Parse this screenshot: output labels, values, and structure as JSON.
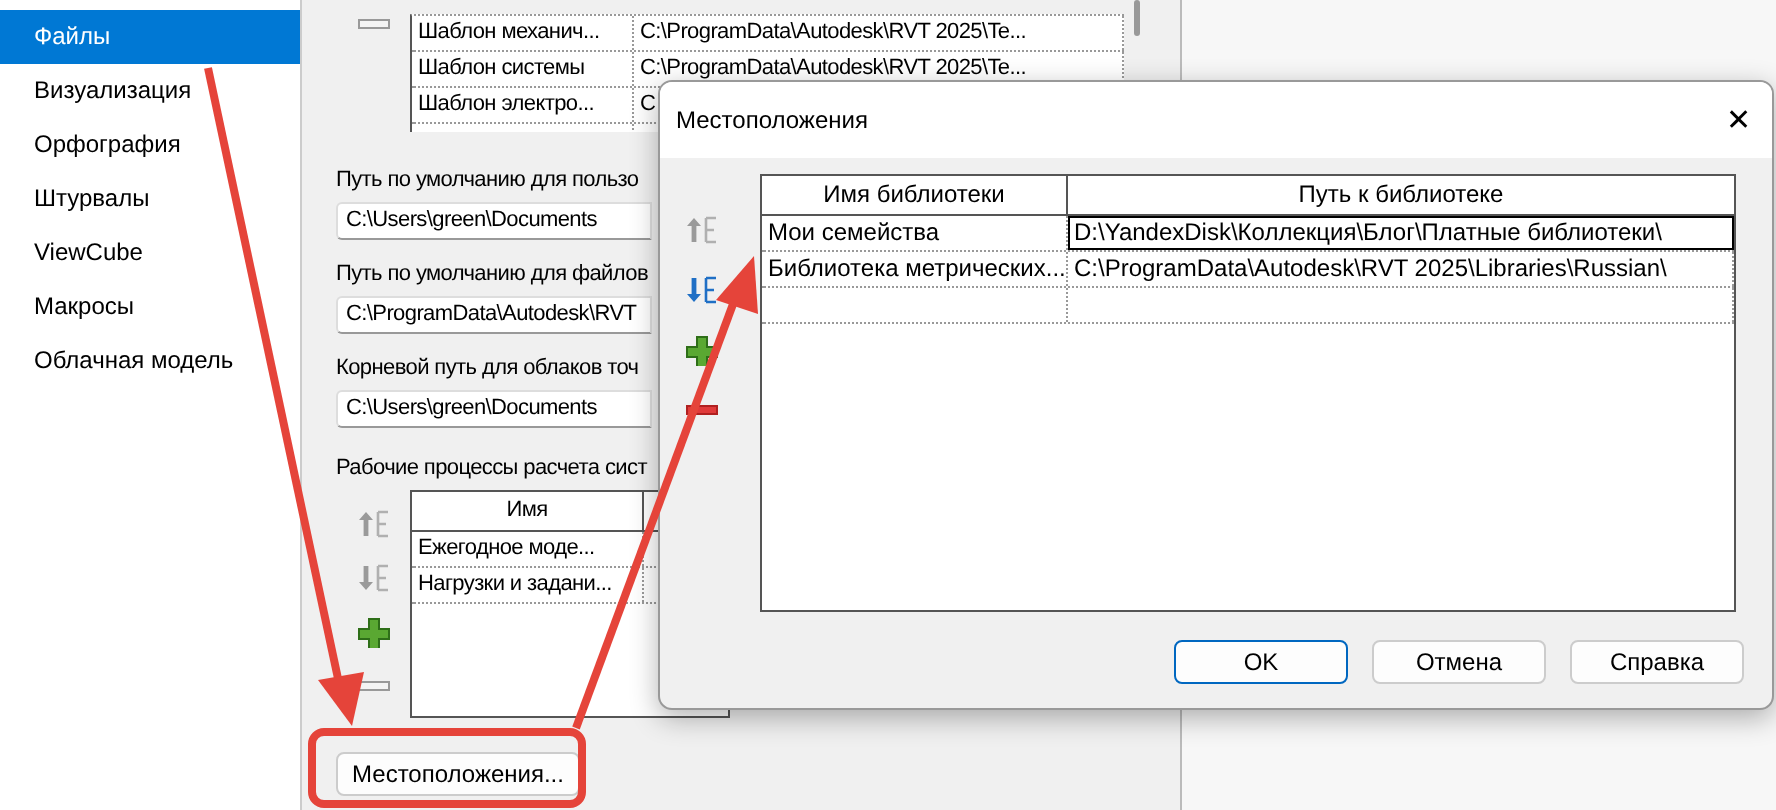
{
  "sidebar": {
    "items": [
      {
        "label": "Файлы",
        "selected": true
      },
      {
        "label": "Визуализация",
        "selected": false
      },
      {
        "label": "Орфография",
        "selected": false
      },
      {
        "label": "Штурвалы",
        "selected": false
      },
      {
        "label": "ViewCube",
        "selected": false
      },
      {
        "label": "Макросы",
        "selected": false
      },
      {
        "label": "Облачная модель",
        "selected": false
      }
    ]
  },
  "options": {
    "templates": {
      "tools": [
        {
          "kind": "remove",
          "disabled": true
        }
      ],
      "rows": [
        [
          "Шаблон механич...",
          "C:\\ProgramData\\Autodesk\\RVT 2025\\Te..."
        ],
        [
          "Шаблон системы",
          "C:\\ProgramData\\Autodesk\\RVT 2025\\Te..."
        ],
        [
          "Шаблон электро...",
          "C"
        ]
      ]
    },
    "fields": [
      {
        "label": "Путь по умолчанию для пользо",
        "value": "C:\\Users\\green\\Documents"
      },
      {
        "label": "Путь по умолчанию для файлов",
        "value": "C:\\ProgramData\\Autodesk\\RVT"
      },
      {
        "label": "Корневой путь для облаков точ",
        "value": "C:\\Users\\green\\Documents"
      }
    ],
    "workflows": {
      "label": "Рабочие процессы расчета сист",
      "tools": [
        {
          "kind": "up",
          "disabled": true
        },
        {
          "kind": "down",
          "disabled": true
        },
        {
          "kind": "add",
          "disabled": false
        },
        {
          "kind": "remove",
          "disabled": true
        }
      ],
      "columns": [
        "Имя"
      ],
      "rows": [
        "Ежегодное моде...",
        "Нагрузки и задани..."
      ]
    },
    "locations_button": "Местоположения..."
  },
  "dialog": {
    "title": "Местоположения",
    "close": "✕",
    "tools": [
      {
        "kind": "up",
        "disabled": true
      },
      {
        "kind": "down",
        "disabled": false
      },
      {
        "kind": "add",
        "disabled": false
      },
      {
        "kind": "remove",
        "disabled": false
      }
    ],
    "columns": [
      "Имя библиотеки",
      "Путь к библиотеке"
    ],
    "rows": [
      {
        "name": "Мои семейства",
        "path": "D:\\YandexDisk\\Коллекция\\Блог\\Платные библиотеки\\",
        "selected": true
      },
      {
        "name": "Библиотека метрических...",
        "path": "C:\\ProgramData\\Autodesk\\RVT 2025\\Libraries\\Russian\\",
        "selected": false
      }
    ],
    "buttons": [
      {
        "label": "OK",
        "default": true
      },
      {
        "label": "Отмена",
        "default": false
      },
      {
        "label": "Справка",
        "default": false
      }
    ]
  }
}
